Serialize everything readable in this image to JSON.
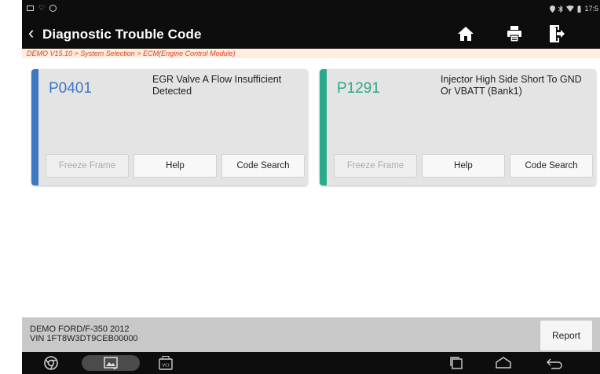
{
  "status_bar": {
    "time": "17:5"
  },
  "header": {
    "title": "Diagnostic Trouble Code"
  },
  "breadcrumb": "DEMO V15.10 > System Selection > ECM(Engine Control Module)",
  "dtc_cards": [
    {
      "code": "P0401",
      "description": "EGR Valve A Flow Insufficient Detected",
      "accent_color": "#3d78c4",
      "code_color": "#3d78c4",
      "buttons": {
        "freeze_frame": "Freeze Frame",
        "help": "Help",
        "code_search": "Code Search"
      }
    },
    {
      "code": "P1291",
      "description": "Injector High Side Short To GND Or VBATT (Bank1)",
      "accent_color": "#2ba98d",
      "code_color": "#2ba98d",
      "buttons": {
        "freeze_frame": "Freeze Frame",
        "help": "Help",
        "code_search": "Code Search"
      }
    }
  ],
  "footer": {
    "vehicle": "DEMO FORD/F-350 2012",
    "vin": "VIN 1FT8W3DT9CEB00000",
    "report_label": "Report"
  },
  "icons": {
    "home": "home-icon",
    "print": "printer-icon",
    "exit": "exit-icon",
    "back": "back-chevron-icon",
    "nav_left": [
      "chrome-icon",
      "screenshot-gallery-icon",
      "vci-icon"
    ],
    "nav_right": [
      "recent-apps-icon",
      "home-nav-icon",
      "back-nav-icon"
    ]
  }
}
